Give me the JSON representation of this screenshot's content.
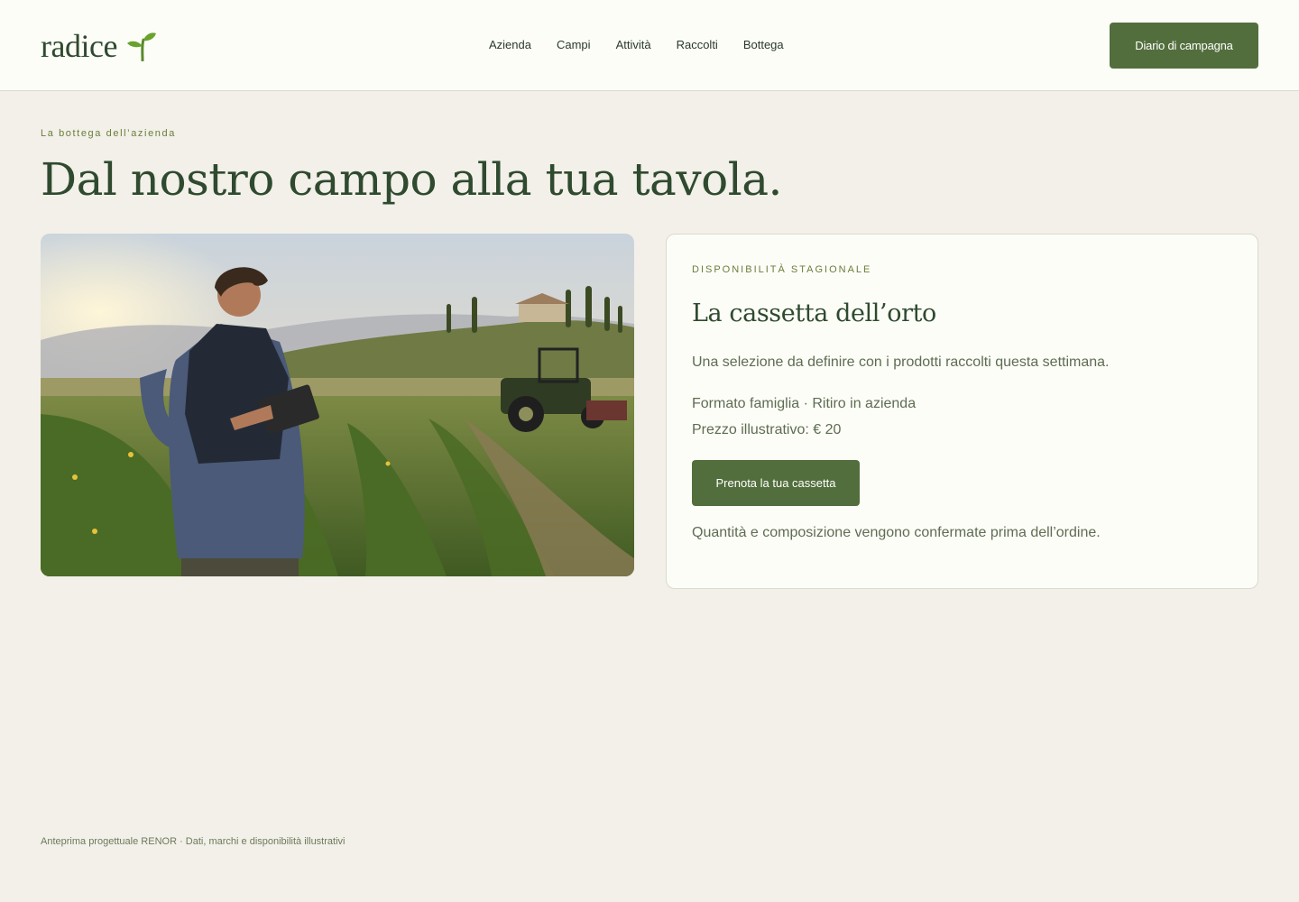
{
  "header": {
    "logo_text": "radice",
    "nav": [
      "Azienda",
      "Campi",
      "Attività",
      "Raccolti",
      "Bottega"
    ],
    "cta_label": "Diario di campagna"
  },
  "hero": {
    "eyebrow": "La bottega dell’azienda",
    "title": "Dal nostro campo alla tua tavola."
  },
  "card": {
    "eyebrow": "DISPONIBILITÀ STAGIONALE",
    "title": "La cassetta dell’orto",
    "description": "Una selezione da definire con i prodotti raccolti questa settimana.",
    "meta": "Formato famiglia · Ritiro in azienda",
    "price": "Prezzo illustrativo: € 20",
    "button_label": "Prenota la tua cassetta",
    "note": "Quantità e composizione vengono confermate prima dell’ordine."
  },
  "footer": {
    "note": "Anteprima progettuale RENOR · Dati, marchi e disponibilità illustrativi"
  },
  "colors": {
    "accent": "#536e3d",
    "background": "#f2f0e8",
    "header_bg": "#fdfdf8",
    "title": "#2f4a2f",
    "eyebrow": "#6b7d3a"
  },
  "icons": [
    "sprout-icon"
  ]
}
